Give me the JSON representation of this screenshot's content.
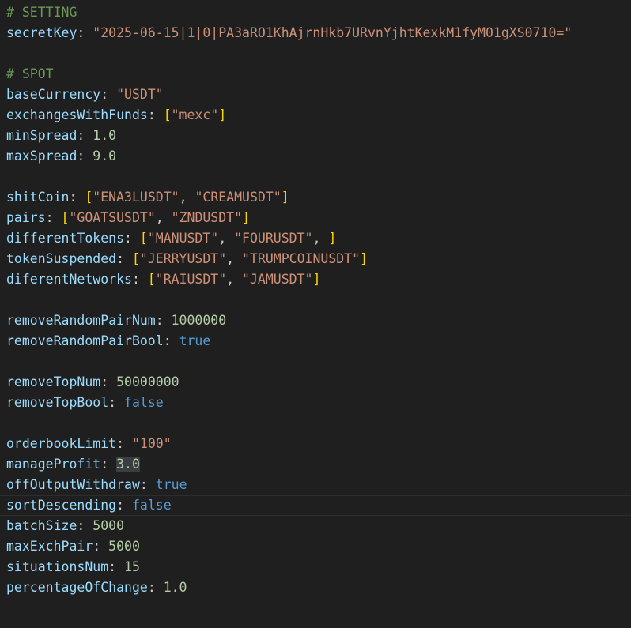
{
  "lines": [
    {
      "type": "comment",
      "text": "# SETTING"
    },
    {
      "type": "kv",
      "key": "secretKey",
      "value": "\"2025-06-15|1|0|PA3aRO1KhAjrnHkb7URvnYjhtKexkM1fyM01gXS0710=\"",
      "vtype": "string"
    },
    {
      "type": "blank"
    },
    {
      "type": "comment",
      "text": "# SPOT"
    },
    {
      "type": "kv",
      "key": "baseCurrency",
      "value": "\"USDT\"",
      "vtype": "string"
    },
    {
      "type": "list",
      "key": "exchangesWithFunds",
      "items": [
        "\"mexc\""
      ],
      "trailing_comma": false
    },
    {
      "type": "kv",
      "key": "minSpread",
      "value": "1.0",
      "vtype": "number"
    },
    {
      "type": "kv",
      "key": "maxSpread",
      "value": "9.0",
      "vtype": "number"
    },
    {
      "type": "blank"
    },
    {
      "type": "list",
      "key": "shitCoin",
      "items": [
        "\"ENA3LUSDT\"",
        "\"CREAMUSDT\""
      ],
      "trailing_comma": false
    },
    {
      "type": "list",
      "key": "pairs",
      "items": [
        "\"GOATSUSDT\"",
        "\"ZNDUSDT\""
      ],
      "trailing_comma": false
    },
    {
      "type": "list",
      "key": "differentTokens",
      "items": [
        "\"MANUSDT\"",
        "\"FOURUSDT\""
      ],
      "trailing_comma": true
    },
    {
      "type": "list",
      "key": "tokenSuspended",
      "items": [
        "\"JERRYUSDT\"",
        "\"TRUMPCOINUSDT\""
      ],
      "trailing_comma": false
    },
    {
      "type": "list",
      "key": "diferentNetworks",
      "items": [
        "\"RAIUSDT\"",
        "\"JAMUSDT\""
      ],
      "trailing_comma": false
    },
    {
      "type": "blank"
    },
    {
      "type": "kv",
      "key": "removeRandomPairNum",
      "value": "1000000",
      "vtype": "number"
    },
    {
      "type": "kv",
      "key": "removeRandomPairBool",
      "value": "true",
      "vtype": "bool"
    },
    {
      "type": "blank"
    },
    {
      "type": "kv",
      "key": "removeTopNum",
      "value": "50000000",
      "vtype": "number"
    },
    {
      "type": "kv",
      "key": "removeTopBool",
      "value": "false",
      "vtype": "bool"
    },
    {
      "type": "blank"
    },
    {
      "type": "kv",
      "key": "orderbookLimit",
      "value": "\"100\"",
      "vtype": "string"
    },
    {
      "type": "kv",
      "key": "manageProfit",
      "value": "3.0",
      "vtype": "number",
      "highlight": true
    },
    {
      "type": "kv",
      "key": "offOutputWithdraw",
      "value": "true",
      "vtype": "bool"
    },
    {
      "type": "kv",
      "key": "sortDescending",
      "value": "false",
      "vtype": "bool",
      "current": true
    },
    {
      "type": "kv",
      "key": "batchSize",
      "value": "5000",
      "vtype": "number"
    },
    {
      "type": "kv",
      "key": "maxExchPair",
      "value": "5000",
      "vtype": "number"
    },
    {
      "type": "kv",
      "key": "situationsNum",
      "value": "15",
      "vtype": "number"
    },
    {
      "type": "kv",
      "key": "percentageOfChange",
      "value": "1.0",
      "vtype": "number"
    }
  ],
  "colors": {
    "background": "#1f1f1f",
    "comment": "#6a9955",
    "key": "#9cdcfe",
    "string": "#ce9178",
    "number": "#b5cea8",
    "boolean": "#569cd6",
    "bracket": "#ffd700",
    "punctuation": "#cccccc"
  }
}
